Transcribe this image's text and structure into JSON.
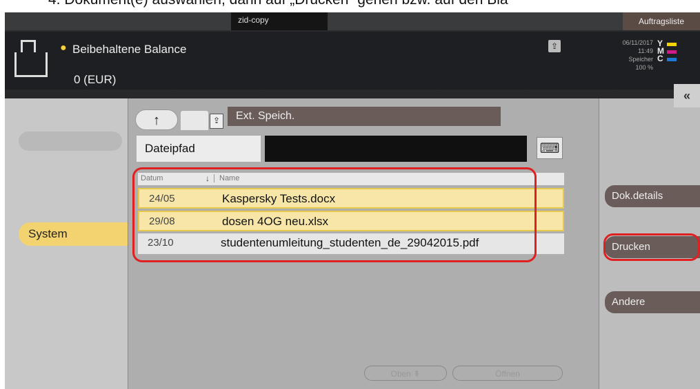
{
  "instruction": "4. Dokument(e) auswählen, dann auf „Drucken“ gehen bzw. auf den Bla",
  "topbar": {
    "job_tab": "zid-copy",
    "list_button": "Auftragsliste"
  },
  "header": {
    "balance_label": "Beibehaltene Balance",
    "balance_value": "0 (EUR)",
    "date": "06/11/2017",
    "time": "11:49",
    "memory_label": "Speicher",
    "memory_value": "100 %",
    "toner": [
      {
        "letter": "Y",
        "color": "#f2d200"
      },
      {
        "letter": "M",
        "color": "#d01a8a"
      },
      {
        "letter": "C",
        "color": "#1e78d8"
      }
    ],
    "collapse_icon": "double-chevron-left-icon"
  },
  "left": {
    "system_tab": "System"
  },
  "panel": {
    "up_button": "↑",
    "location_title": "Ext. Speich.",
    "path_label": "Dateipfad",
    "path_value": "",
    "keyboard_icon": "keyboard-icon",
    "columns": {
      "date": "Datum",
      "name": "Name"
    },
    "files": [
      {
        "date": "24/05",
        "name": "Kaspersky Tests.docx",
        "selected": true
      },
      {
        "date": "29/08",
        "name": "dosen 4OG neu.xlsx",
        "selected": true
      },
      {
        "date": "23/10",
        "name": "studentenumleitung_studenten_de_29042015.pdf",
        "selected": false
      }
    ],
    "pager": {
      "up": "Oben",
      "open": "Öffnen"
    }
  },
  "actions": {
    "details": "Dok.details",
    "print": "Drucken",
    "other": "Andere"
  }
}
